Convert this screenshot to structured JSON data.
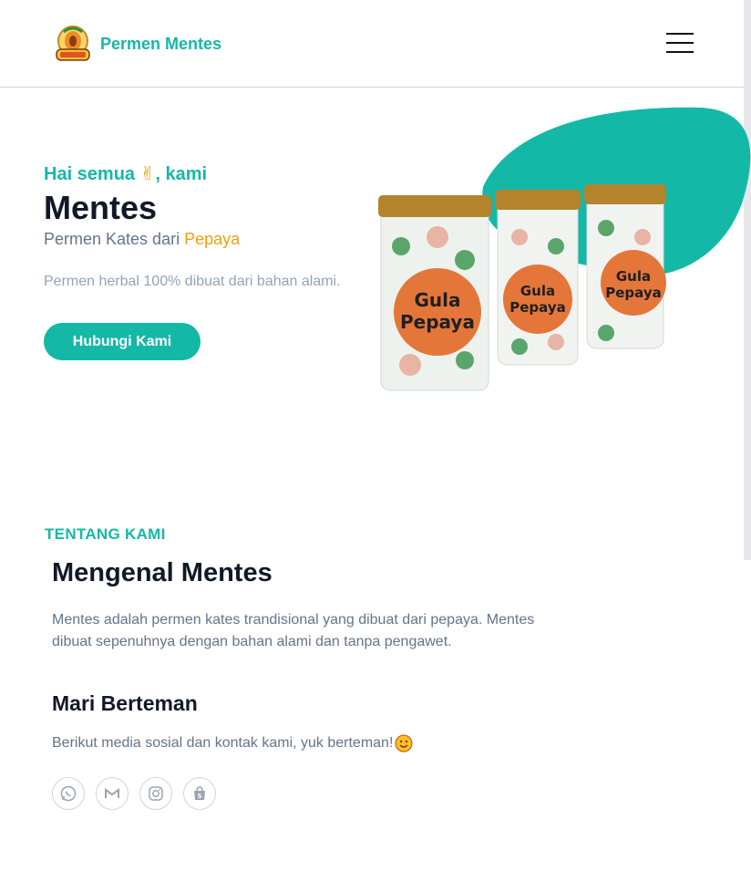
{
  "header": {
    "brand_name": "Permen Mentes",
    "logo_icon": "papaya-logo-icon"
  },
  "hero": {
    "greeting_prefix": "Hai semua ",
    "greeting_emoji": "✌",
    "greeting_suffix": ", kami",
    "title": "Mentes",
    "subtitle_prefix": "Permen Kates dari ",
    "subtitle_accent": "Pepaya",
    "description": "Permen herbal 100% dibuat dari bahan alami.",
    "cta_label": "Hubungi Kami",
    "product_label_line1": "Gula",
    "product_label_line2": "Pepaya"
  },
  "about": {
    "section_label": "TENTANG KAMI",
    "title": "Mengenal Mentes",
    "text": "Mentes adalah permen kates trandisional yang dibuat dari pepaya. Mentes dibuat sepenuhnya dengan bahan alami dan tanpa pengawet.",
    "friends_title": "Mari Berteman",
    "friends_text": "Berikut media sosial dan kontak kami, yuk berteman!"
  },
  "socials": [
    "whatsapp-icon",
    "gmail-icon",
    "instagram-icon",
    "shopee-icon"
  ],
  "colors": {
    "accent": "#14b8a6",
    "highlight": "#f59e0b",
    "text_dark": "#111827",
    "text_muted": "#64748b"
  }
}
